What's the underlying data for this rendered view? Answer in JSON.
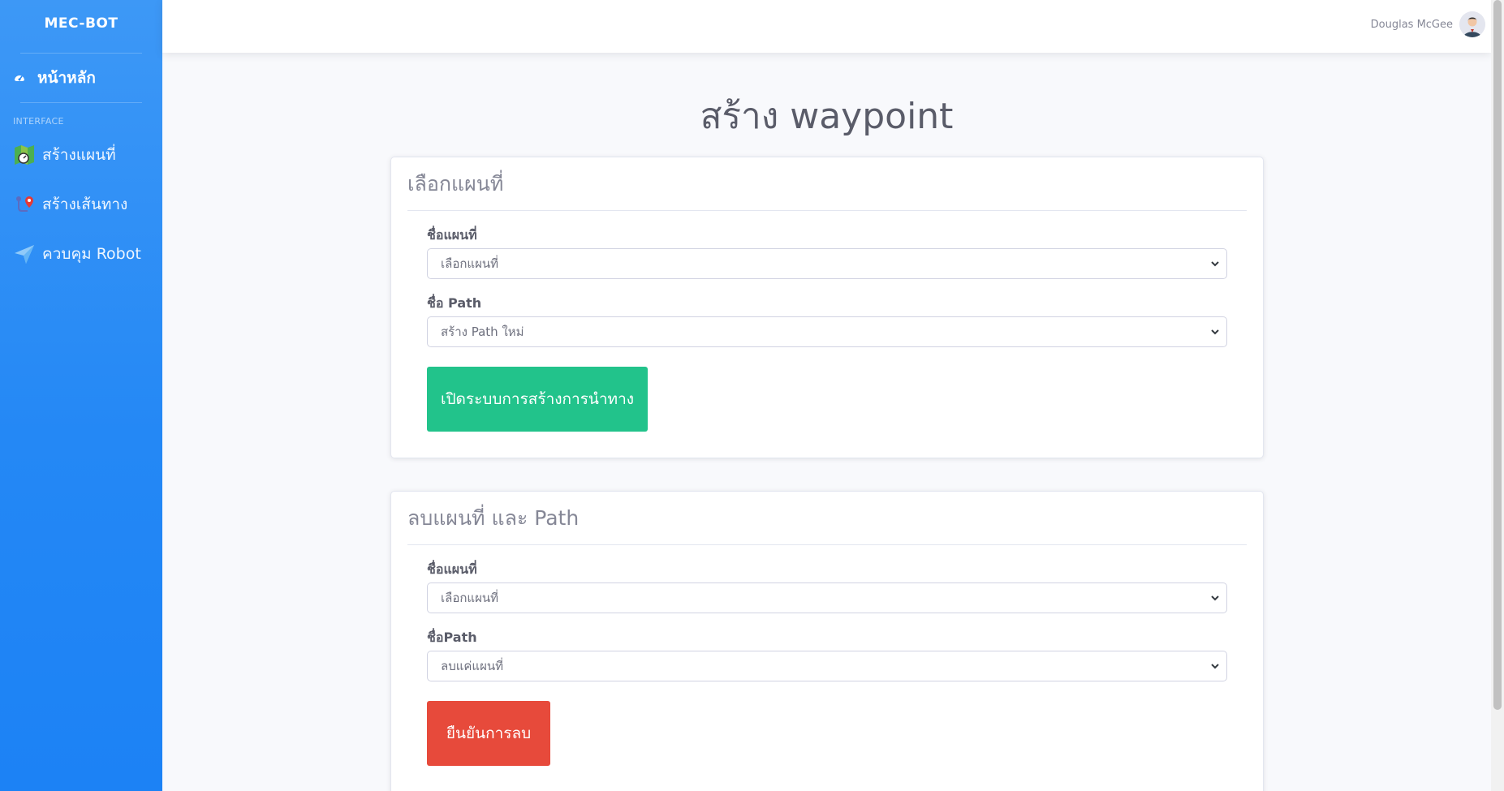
{
  "sidebar": {
    "brand": "MEC-BOT",
    "home_label": "หน้าหลัก",
    "section_heading": "INTERFACE",
    "items": [
      {
        "label": "สร้างแผนที่",
        "icon": "map-icon"
      },
      {
        "label": "สร้างเส้นทาง",
        "icon": "route-icon"
      },
      {
        "label": "ควบคุม Robot",
        "icon": "paper-plane-icon"
      }
    ]
  },
  "topbar": {
    "user_name": "Douglas McGee"
  },
  "page": {
    "title": "สร้าง waypoint"
  },
  "select_map_card": {
    "header": "เลือกแผนที่",
    "map_label": "ชื่อแผนที่",
    "map_value": "เลือกแผนที่",
    "path_label": "ชื่อ Path",
    "path_value": "สร้าง Path ใหม่",
    "button_label": "เปิดระบบการสร้างการนำทาง"
  },
  "delete_card": {
    "header": "ลบแผนที่ และ Path",
    "map_label": "ชื่อแผนที่",
    "map_value": "เลือกแผนที่",
    "path_label": "ชื่อPath",
    "path_value": "ลบแค่แผนที่",
    "button_label": "ยืนยันการลบ"
  },
  "colors": {
    "sidebar": "#2488f5",
    "success": "#22c38b",
    "danger": "#e74a3b"
  }
}
